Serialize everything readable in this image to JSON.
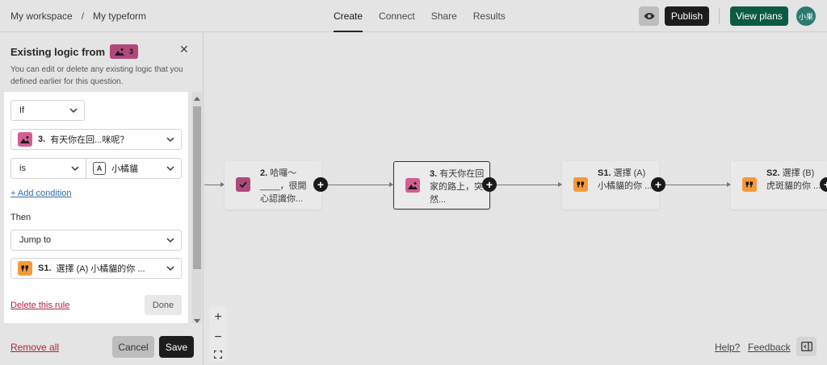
{
  "header": {
    "breadcrumb": [
      "My workspace",
      "My typeform"
    ],
    "breadcrumb_sep": "/",
    "tabs": [
      {
        "label": "Create",
        "active": true
      },
      {
        "label": "Connect",
        "active": false
      },
      {
        "label": "Share",
        "active": false
      },
      {
        "label": "Results",
        "active": false
      }
    ],
    "preview_icon": "eye-icon",
    "publish_label": "Publish",
    "view_plans_label": "View plans",
    "avatar_text": "小果"
  },
  "panel": {
    "title": "Existing logic from",
    "question_badge_number": "3",
    "description": "You can edit or delete any existing logic that you defined earlier for this question.",
    "rule": {
      "if_label": "If",
      "question_number": "3.",
      "question_text": "有天你在回...咪呢？",
      "operator": "is",
      "value_letter": "A",
      "value_text": "小橘貓",
      "add_condition_label": "+ Add condition",
      "then_label": "Then",
      "action": "Jump to",
      "target_number": "S1.",
      "target_text": "選擇 (A) 小橘貓的你 ...",
      "delete_label": "Delete this rule",
      "done_label": "Done"
    },
    "remove_all_label": "Remove all",
    "cancel_label": "Cancel",
    "save_label": "Save"
  },
  "canvas": {
    "nodes": [
      {
        "number": "2.",
        "text": "哈囉～____，很開心認識你...",
        "icon": "checkbox-icon",
        "color": "#b0497b"
      },
      {
        "number": "3.",
        "text": "有天你在回家的路上，突然...",
        "icon": "picture-icon",
        "color": "#d25e94"
      },
      {
        "number": "S1.",
        "text": "選擇 (A) 小橘貓的你 ...",
        "icon": "quote-icon",
        "color": "#f59a3a"
      },
      {
        "number": "S2.",
        "text": "選擇 (B) 虎斑貓的你 ...",
        "icon": "quote-icon",
        "color": "#f59a3a"
      }
    ],
    "zoom": {
      "in": "+",
      "out": "−"
    }
  },
  "footer": {
    "help_label": "Help?",
    "feedback_label": "Feedback"
  }
}
